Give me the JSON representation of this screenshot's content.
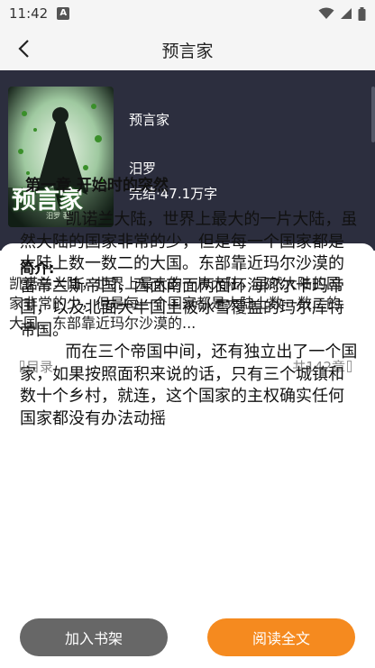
{
  "status_bar": {
    "time": "11:42",
    "notification_letter": "A"
  },
  "navbar": {
    "title": "预言家"
  },
  "book": {
    "title": "预言家",
    "author": "汨罗",
    "meta": "完结·47.1万字",
    "cover_text": "预言家",
    "cover_sub": "汨罗 著"
  },
  "intro": {
    "heading": "简介:",
    "text": "  凯诺兰大陆，世界上最大的一片大陆，虽然大陆的国家非常的少，但是每一个国家都是大陆上数一数二的大国。东部靠近玛尔沙漠的..."
  },
  "toc": {
    "label": "目录",
    "count": "共142章"
  },
  "chapter": {
    "title": "第一章 开始时的突然",
    "paragraphs": [
      "凯诺兰大陆，世界上最大的一片大陆，虽然大陆的国家非常的少，但是每一个国家都是大陆上数一数二的大国。东部靠近玛尔沙漠的雷帝兰斯帝国，西面南面两面环海阿尔卡玛帝国，以及北面大半国土被冰雪覆盖的玛尔库特帝国。",
      "而在三个帝国中间，还有独立出了一个国家，如果按照面积来说的话，只有三个城镇和数十个乡村，就连，这个国家的主权确实任何国家都没有办法动摇"
    ]
  },
  "buttons": {
    "add_shelf": "加入书架",
    "read_full": "阅读全文"
  },
  "colors": {
    "hero_bg": "#2c2e3e",
    "accent": "#f58a1f"
  }
}
